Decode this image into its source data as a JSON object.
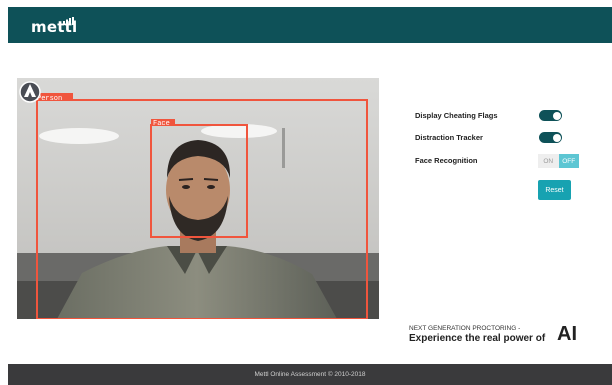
{
  "header": {
    "logo_text": "mettl"
  },
  "video": {
    "detections": [
      {
        "label": "Person"
      },
      {
        "label": "Face"
      }
    ]
  },
  "controls": {
    "display_cheating_flags": {
      "label": "Display Cheating Flags",
      "enabled": true
    },
    "distraction_tracker": {
      "label": "Distraction Tracker",
      "enabled": true
    },
    "face_recognition": {
      "label": "Face Recognition",
      "on_label": "ON",
      "off_label": "OFF",
      "selected": "OFF"
    },
    "reset_label": "Reset"
  },
  "tagline": {
    "small": "NEXT GENERATION PROCTORING -",
    "big": "Experience the real power of",
    "highlight": "AI"
  },
  "footer": {
    "text": "Mettl Online Assessment © 2010-2018"
  },
  "colors": {
    "header_bg": "#0e5158",
    "toggle_on": "#0e5158",
    "accent": "#17a2b1",
    "detection_box": "#f0553d",
    "footer_bg": "#3a3a3c"
  }
}
